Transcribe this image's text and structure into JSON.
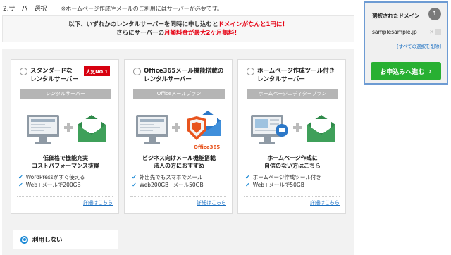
{
  "header": {
    "step_title": "2.サーバー選択",
    "step_note": "※ホームページ作成やメールのご利用にはサーバーが必要です。"
  },
  "notice": {
    "line1_a": "以下、いずれかのレンタルサーバーを同時に申し込むと",
    "line1_red": "ドメインがなんと1円に！",
    "line2_a": "さらにサーバーの",
    "line2_red": "月額料金が最大2ヶ月無料！"
  },
  "plans": [
    {
      "name_line1": "スタンダードな",
      "name_line2": "レンタルサーバー",
      "badge": "人気NO.1",
      "bar_label": "レンタルサーバー",
      "desc_line1": "低価格で機能充実",
      "desc_line2": "コストパフォーマンス抜群",
      "features": [
        "WordPressがすぐ使える",
        "Web+メールで200GB"
      ],
      "link": "詳細はこちら",
      "icons": [
        "monitor-icon",
        "plus-icon",
        "mail-icon"
      ]
    },
    {
      "name_line1": "Office365メール機能搭載の",
      "name_line2": "レンタルサーバー",
      "bar_label": "Officeメールプラン",
      "logo_text": "Office365",
      "desc_line1": "ビジネス向けメール機能搭載",
      "desc_line2": "法人の方におすすめ",
      "features": [
        "外出先でもスマホでメール",
        "Web200GB+メール50GB"
      ],
      "link": "詳細はこちら",
      "icons": [
        "monitor-icon",
        "plus-icon",
        "shield-mail-icon"
      ]
    },
    {
      "name_line1": "ホームページ作成ツール付き",
      "name_line2": "レンタルサーバー",
      "bar_label": "ホームページエディタープラン",
      "desc_line1": "ホームページ作成に",
      "desc_line2": "自信のない方はこちら",
      "features": [
        "ホームページ作成ツール付き",
        "Web+メールで50GB"
      ],
      "link": "詳細はこちら",
      "icons": [
        "monitor-editor-icon",
        "plus-icon",
        "mail-icon"
      ]
    }
  ],
  "no_use": {
    "label": "利用しない"
  },
  "sidebar": {
    "title": "選択されたドメイン",
    "count": "1",
    "domain": "samplesample.jp",
    "remove_symbol": "✕",
    "clear_all": "[すべての選択を削除]",
    "proceed": "お申込みへ進む",
    "proceed_arrow": "›"
  },
  "colors": {
    "accent_red": "#e60012",
    "badge_red": "#d7000f",
    "button_green": "#28b032",
    "link_blue": "#1a6fc2",
    "sidebar_border": "#6d9bd3",
    "check_blue": "#1d8ad6"
  }
}
